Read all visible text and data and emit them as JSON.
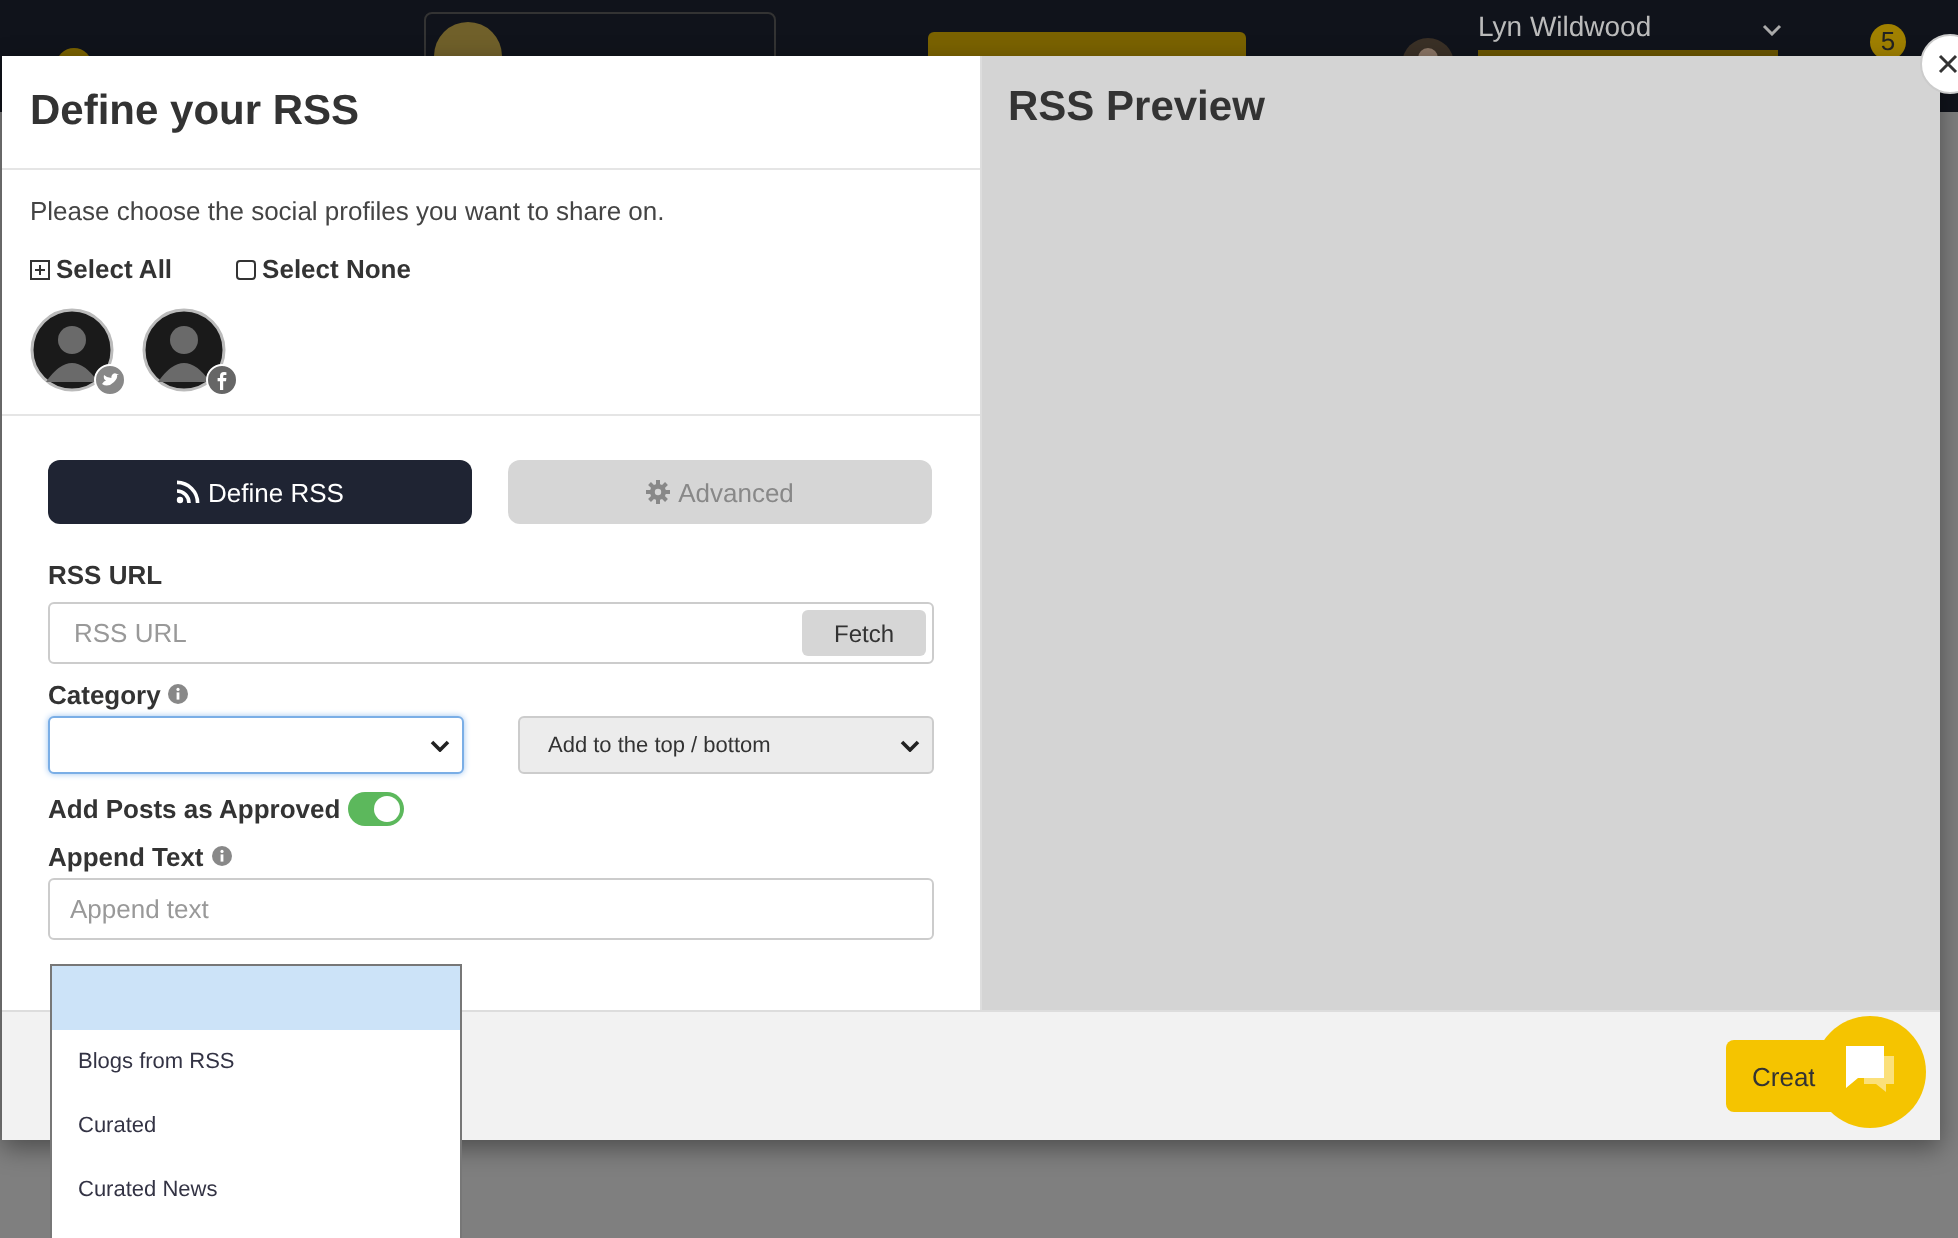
{
  "header": {
    "user_name": "Lyn Wildwood",
    "notifications": "5"
  },
  "modal": {
    "title": "Define your RSS",
    "instructions": "Please choose the social profiles you want to share on.",
    "select_all": "Select All",
    "select_none": "Select None",
    "profiles": [
      {
        "kind": "twitter"
      },
      {
        "kind": "facebook"
      }
    ],
    "tabs": [
      {
        "label": "Define RSS",
        "kind": "rss",
        "selected": true
      },
      {
        "label": "Advanced",
        "kind": "gear",
        "selected": false
      }
    ],
    "rss_url": {
      "label": "RSS URL",
      "placeholder": "RSS URL",
      "button": "Fetch"
    },
    "category": {
      "label": "Category",
      "open": true,
      "blank_highlighted": true,
      "options": [
        {
          "label": "Blogs from RSS",
          "selected": false
        },
        {
          "label": "Curated",
          "selected": false
        },
        {
          "label": "Curated News",
          "selected": false
        }
      ]
    },
    "position": {
      "value": "Add to the top / bottom"
    },
    "approved": {
      "label": "Add Posts as Approved",
      "on": true
    },
    "append_text": {
      "label": "Append Text",
      "placeholder": "Append text"
    },
    "preview_title": "RSS Preview",
    "create_button": "Creat"
  }
}
